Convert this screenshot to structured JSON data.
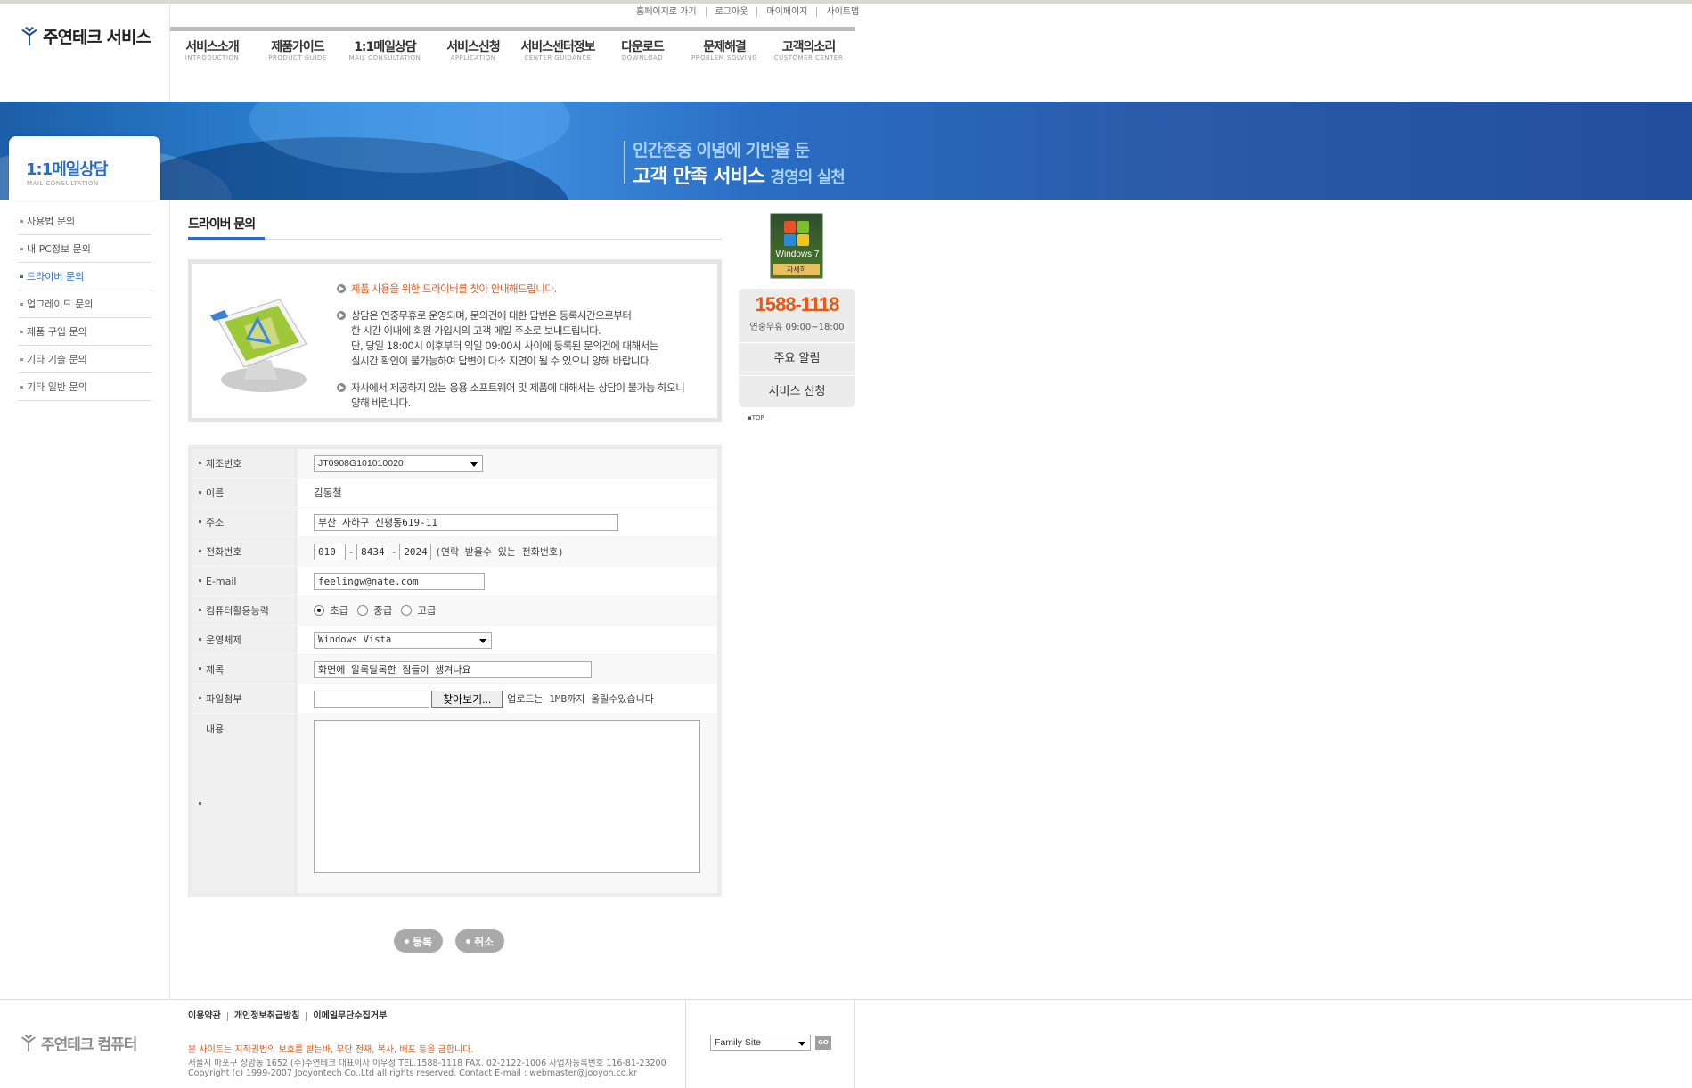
{
  "header": {
    "logo_text": "주연테크 서비스",
    "utility_links": [
      "홈페이지로 가기",
      "로그아웃",
      "마이페이지",
      "사이트맵"
    ],
    "gnb": [
      {
        "ko": "서비스소개",
        "en": "INTRODUCTION"
      },
      {
        "ko": "제품가이드",
        "en": "PRODUCT GUIDE"
      },
      {
        "ko": "1:1메일상담",
        "en": "MAIL CONSULTATION"
      },
      {
        "ko": "서비스신청",
        "en": "APPLICATION"
      },
      {
        "ko": "서비스센터정보",
        "en": "CENTER GUIDANCE"
      },
      {
        "ko": "다운로드",
        "en": "DOWNLOAD"
      },
      {
        "ko": "문제해결",
        "en": "PROBLEM SOLVING"
      },
      {
        "ko": "고객의소리",
        "en": "CUSTOMER CENTER"
      }
    ]
  },
  "banner": {
    "line1": "인간존중 이념에 기반을 둔",
    "line2_main": "고객 만족 서비스",
    "line2_sub": "경영의 실천"
  },
  "sidebar": {
    "title": "1:1메일상담",
    "subtitle": "MAIL CONSULTATION",
    "items": [
      "사용법 문의",
      "내 PC정보 문의",
      "드라이버 문의",
      "업그레이드 문의",
      "제품 구입 문의",
      "기타 기술 문의",
      "기타 일반 문의"
    ],
    "active_index": 2
  },
  "main": {
    "title": "드라이버 문의",
    "info": {
      "line1": "제품 사용을 위한 드라이버를 찾아 안내해드립니다.",
      "line2": [
        "상담은 연중무휴로 운영되며, 문의건에 대한 답변은 등록시간으로부터",
        "한 시간 이내에 회원 가입시의 고객 메일 주소로 보내드립니다.",
        "단, 당일 18:00시 이후부터 익일 09:00시 사이에 등록된 문의건에 대해서는",
        "실시간 확인이 불가능하여 답변이 다소 지연이 될 수 있으니 양해 바랍니다."
      ],
      "line3": [
        "자사에서 제공하지 않는 응용 소프트웨어 및 제품에 대해서는 상담이 불가능 하오니",
        "양해 바랍니다."
      ]
    },
    "form": {
      "serial": {
        "label": "제조번호",
        "value": "JT0908G101010020"
      },
      "name": {
        "label": "이름",
        "value": "김동철"
      },
      "address": {
        "label": "주소",
        "value": "부산 사하구 신평동619-11"
      },
      "phone": {
        "label": "전화번호",
        "p1": "010",
        "p2": "8434",
        "p3": "2024",
        "hint": "(연락 받을수 있는 전화번호)"
      },
      "email": {
        "label": "E-mail",
        "value": "feelingw@nate.com"
      },
      "skill": {
        "label": "컴퓨터활용능력",
        "options": [
          "초급",
          "중급",
          "고급"
        ],
        "selected": 0
      },
      "os": {
        "label": "운영체제",
        "value": "Windows Vista"
      },
      "subject": {
        "label": "제목",
        "value": "화면에 알록달록한 점들이 생겨나요"
      },
      "file": {
        "label": "파일첨부",
        "button": "찾아보기...",
        "hint": "업로드는 1MB까지 올릴수있습니다"
      },
      "content": {
        "label": "내용",
        "value": ""
      }
    },
    "buttons": {
      "submit": "등록",
      "cancel": "취소"
    }
  },
  "quick": {
    "win7_label": "Windows 7",
    "win7_sub": "자세히",
    "phone": "1588-1118",
    "hours": "연중무휴 09:00~18:00",
    "notice": "주요 알림",
    "apply": "서비스 신청",
    "top": "TOP"
  },
  "footer": {
    "logo_text": "주연테크 컴퓨터",
    "links": [
      "이용약관",
      "개인정보취급방침",
      "이메일무단수집거부"
    ],
    "warning": "본 사이트는 지적권법의 보호를 받는바, 무단 전재, 복사, 배포 등을 금합니다.",
    "address": "서울시 마포구 상암동 1652 (주)주연테크  대표이사 이우정  TEL.1588-1118  FAX. 02-2122-1006  사업자등록번호 116-81-23200",
    "copyright": "Copyright (c) 1999-2007 Jooyontech Co.,Ltd all rights reserved.    Contact E-mail : webmaster@jooyon.co.kr",
    "family_site": "Family Site",
    "go": "GO"
  }
}
